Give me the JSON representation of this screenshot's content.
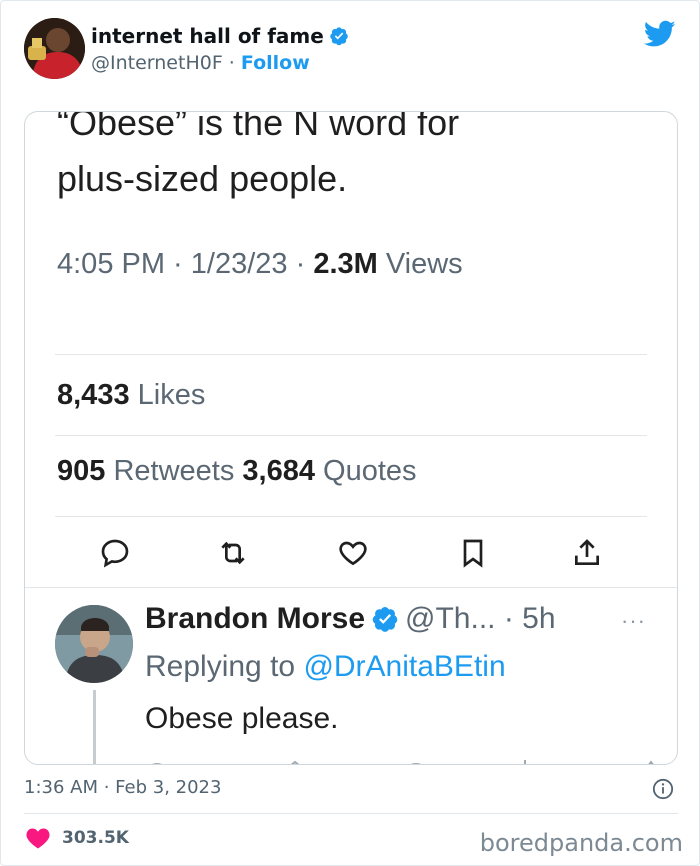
{
  "tweet": {
    "author_name": "internet hall of fame",
    "author_handle": "@InternetH0F",
    "separator": "·",
    "follow_label": "Follow",
    "timestamp": "1:36 AM · Feb 3, 2023",
    "like_count": "303.5K"
  },
  "embedded": {
    "line1": "“Obese” is the N word for",
    "line2": "plus-sized people.",
    "meta_time": "4:05 PM · 1/23/23 · ",
    "meta_views_count": "2.3M",
    "meta_views_label": " Views",
    "likes_count": "8,433",
    "likes_label": " Likes",
    "retweets_count": "905",
    "retweets_label": " Retweets ",
    "quotes_count": "3,684",
    "quotes_label": " Quotes",
    "reply": {
      "name": "Brandon Morse",
      "handle": "@Th... · 5h",
      "more": "···",
      "replying_prefix": "Replying to ",
      "replying_mention": "@DrAnitaBEtin",
      "text": "Obese please."
    }
  },
  "watermark": "boredpanda.com",
  "colors": {
    "accent": "#1d9bf0",
    "heart": "#f91880",
    "text_secondary": "#536471"
  },
  "icons": [
    "verified-icon",
    "twitter-bird-icon",
    "reply-icon",
    "retweet-icon",
    "like-icon",
    "bookmark-icon",
    "share-icon",
    "info-icon",
    "heart-icon"
  ]
}
